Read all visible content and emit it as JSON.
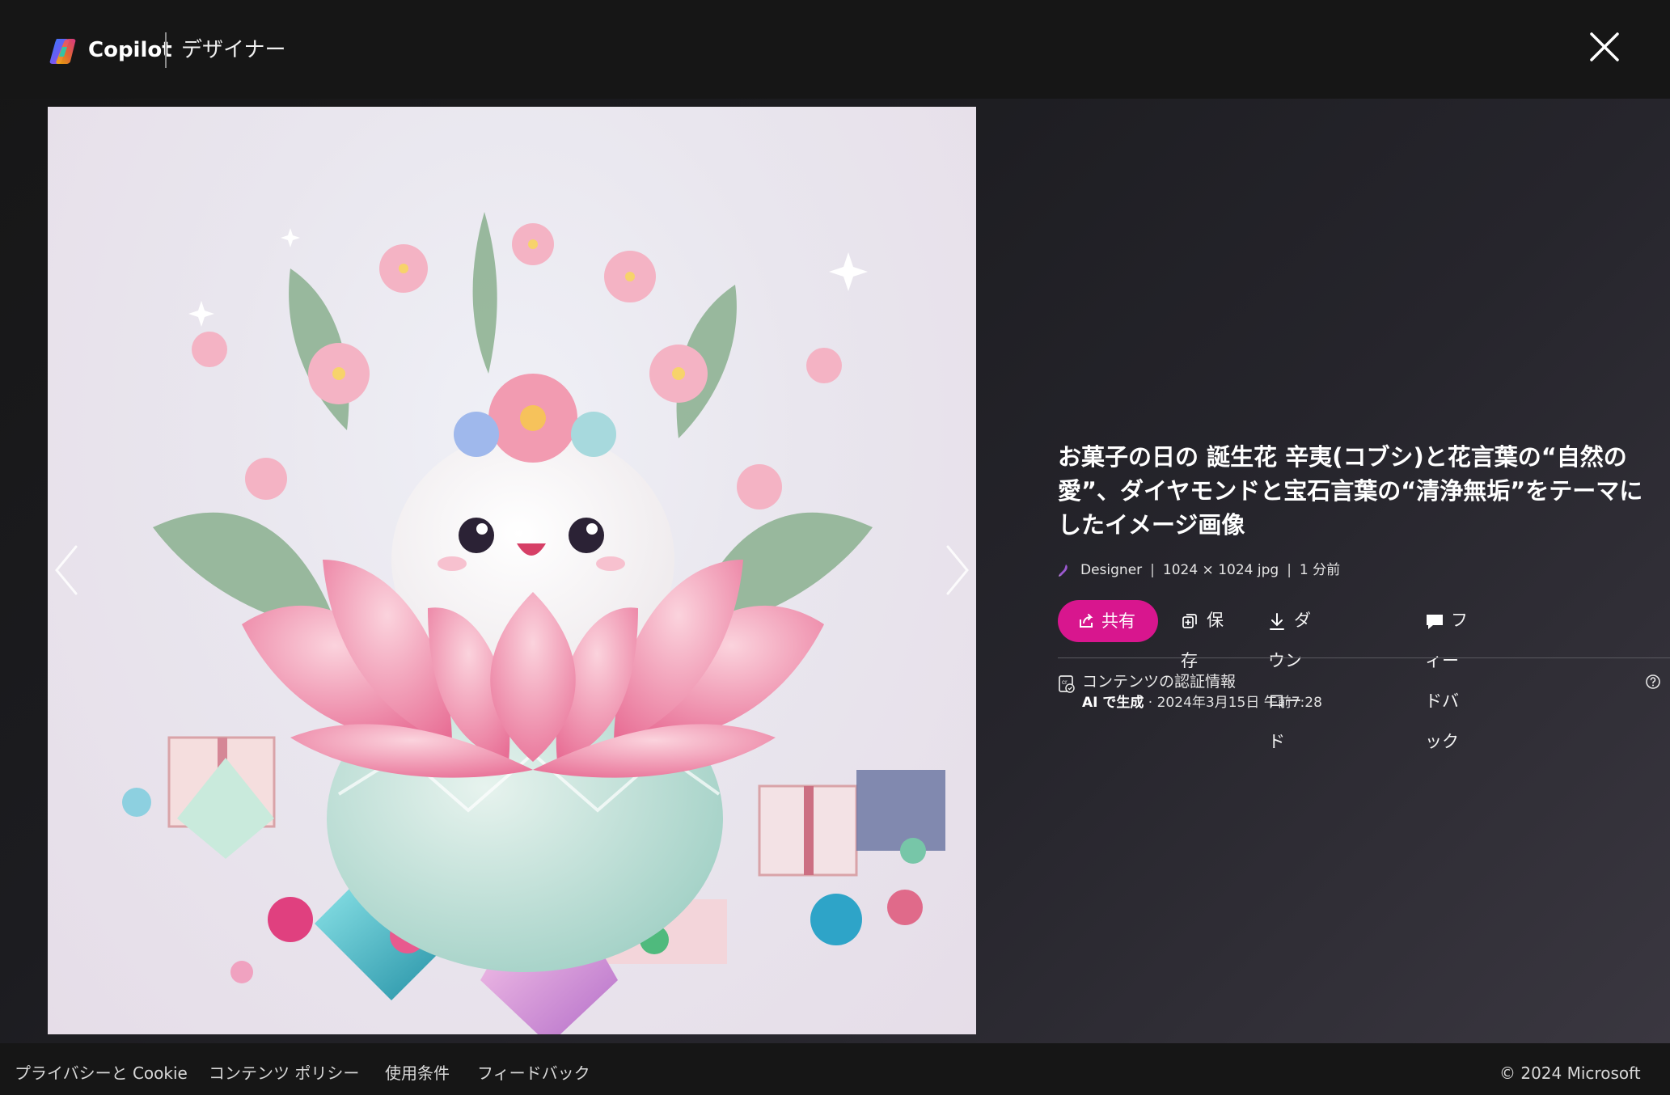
{
  "header": {
    "brand": "Copilot",
    "product": "デザイナー",
    "close_label": "close-icon"
  },
  "image": {
    "alt": "お菓子の日の 誕生花 辛夷(コブシ)と花言葉の“自然の愛”、ダイヤモンドと宝石言葉の“清浄無垢”をテーマにしたイメージ画像"
  },
  "details": {
    "title": "お菓子の日の 誕生花 辛夷(コブシ)と花言葉の“自然の愛”、ダイヤモンドと宝石言葉の“清浄無垢”をテーマにしたイメージ画像",
    "meta": {
      "source": "Designer",
      "dimensions": "1024 × 1024 jpg",
      "time": "1 分前"
    },
    "actions": {
      "share": "共有",
      "save": "保存",
      "download": "ダウンロード",
      "feedback": "フィードバック"
    },
    "credentials": {
      "title": "コンテンツの認証情報",
      "generated": "AI で生成",
      "date": " · 2024年3月15日 午前7:28"
    }
  },
  "footer": {
    "privacy": "プライバシーと Cookie",
    "content_policy": "コンテンツ ポリシー",
    "terms": "使用条件",
    "feedback": "フィードバック",
    "copyright": "© 2024 Microsoft"
  },
  "colors": {
    "accent": "#d8168e",
    "background": "#161616"
  },
  "icons": [
    "copilot-logo-icon",
    "close-icon",
    "chevron-left-icon",
    "chevron-right-icon",
    "designer-pencil-icon",
    "share-icon",
    "save-icon",
    "download-icon",
    "feedback-icon",
    "content-credentials-icon",
    "help-icon"
  ]
}
